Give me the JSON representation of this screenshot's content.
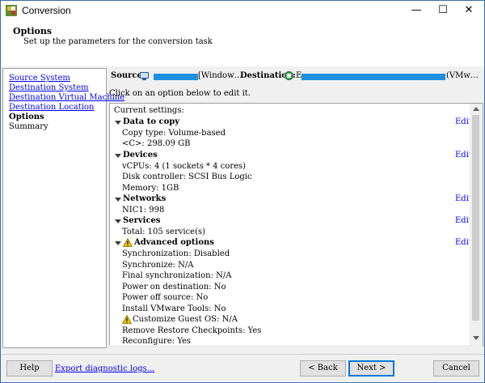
{
  "window": {
    "title": "Conversion",
    "controls": {
      "minimize": "—",
      "maximize": "☐",
      "close": "✕"
    }
  },
  "header": {
    "title": "Options",
    "subtitle": "Set up the parameters for the conversion task"
  },
  "nav": {
    "items": [
      {
        "label": "Source System",
        "link": true
      },
      {
        "label": "Destination System",
        "link": true
      },
      {
        "label": "Destination Virtual Machine",
        "link": true
      },
      {
        "label": "Destination Location",
        "link": true
      },
      {
        "label": "Options",
        "current": true
      },
      {
        "label": "Summary"
      }
    ]
  },
  "summary_line": {
    "source_label": "Source:",
    "source_suffix": "[Window…",
    "destination_label": "Destination:",
    "destination_prefix": "E",
    "destination_suffix": "(VMw…"
  },
  "instruction": "Click on an option below to edit it.",
  "settings": {
    "heading": "Current settings:",
    "edit_label": "Edit",
    "sections": [
      {
        "title": "Data to copy",
        "lines": [
          "Copy type: Volume-based",
          "<C>: 298.09 GB"
        ]
      },
      {
        "title": "Devices",
        "lines": [
          "vCPUs: 4 (1 sockets * 4 cores)",
          "Disk controller: SCSI Bus Logic",
          "Memory: 1GB"
        ]
      },
      {
        "title": "Networks",
        "lines": [
          "NIC1: 998"
        ]
      },
      {
        "title": "Services",
        "lines": [
          "Total: 105 service(s)"
        ]
      },
      {
        "title": "Advanced options",
        "warning": true,
        "lines": [
          "Synchronization: Disabled",
          "Synchronize: N/A",
          "Final synchronization: N/A",
          "Power on destination: No",
          "Power off source: No",
          "Install VMware Tools: No",
          "Customize Guest OS: N/A",
          "Remove Restore Checkpoints: Yes",
          "Reconfigure: Yes"
        ]
      }
    ]
  },
  "footer": {
    "help": "Help",
    "export": "Export diagnostic logs...",
    "back": "< Back",
    "next": "Next >",
    "cancel": "Cancel"
  },
  "colors": {
    "link": "#0000ee",
    "accent": "#0078d7",
    "redacted_bar": "#1f8fe0",
    "warning": "#f2c200"
  }
}
